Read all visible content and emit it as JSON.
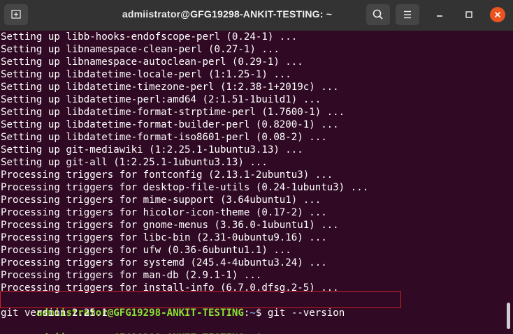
{
  "window": {
    "title": "admiistrator@GFG19298-ANKIT-TESTING: ~",
    "icons": {
      "new_tab": "new-tab-icon",
      "search": "search-icon",
      "menu": "hamburger-menu-icon",
      "minimize": "minimize-icon",
      "maximize": "maximize-icon",
      "close": "close-icon"
    },
    "colors": {
      "titlebar": "#333333",
      "terminal_background": "#300a24",
      "close_button": "#e95420",
      "prompt_user": "#8ae234",
      "prompt_path": "#729fcf",
      "highlight_border": "#d01f2a"
    }
  },
  "terminal": {
    "output_lines": [
      "Setting up libb-hooks-endofscope-perl (0.24-1) ...",
      "Setting up libnamespace-clean-perl (0.27-1) ...",
      "Setting up libnamespace-autoclean-perl (0.29-1) ...",
      "Setting up libdatetime-locale-perl (1:1.25-1) ...",
      "Setting up libdatetime-timezone-perl (1:2.38-1+2019c) ...",
      "Setting up libdatetime-perl:amd64 (2:1.51-1build1) ...",
      "Setting up libdatetime-format-strptime-perl (1.7600-1) ...",
      "Setting up libdatetime-format-builder-perl (0.8200-1) ...",
      "Setting up libdatetime-format-iso8601-perl (0.08-2) ...",
      "Setting up git-mediawiki (1:2.25.1-1ubuntu3.13) ...",
      "Setting up git-all (1:2.25.1-1ubuntu3.13) ...",
      "Processing triggers for fontconfig (2.13.1-2ubuntu3) ...",
      "Processing triggers for desktop-file-utils (0.24-1ubuntu3) ...",
      "Processing triggers for mime-support (3.64ubuntu1) ...",
      "Processing triggers for hicolor-icon-theme (0.17-2) ...",
      "Processing triggers for gnome-menus (3.36.0-1ubuntu1) ...",
      "Processing triggers for libc-bin (2.31-0ubuntu9.16) ...",
      "Processing triggers for ufw (0.36-6ubuntu1.1) ...",
      "Processing triggers for systemd (245.4-4ubuntu3.24) ...",
      "Processing triggers for man-db (2.9.1-1) ...",
      "Processing triggers for install-info (6.7.0.dfsg.2-5) ..."
    ],
    "prompt": {
      "user_host": "admiistrator@GFG19298-ANKIT-TESTING",
      "separator": ":",
      "path": "~",
      "symbol": "$"
    },
    "command": " git --version",
    "command_output": "git version 2.25.1",
    "final_prompt_input": ""
  }
}
